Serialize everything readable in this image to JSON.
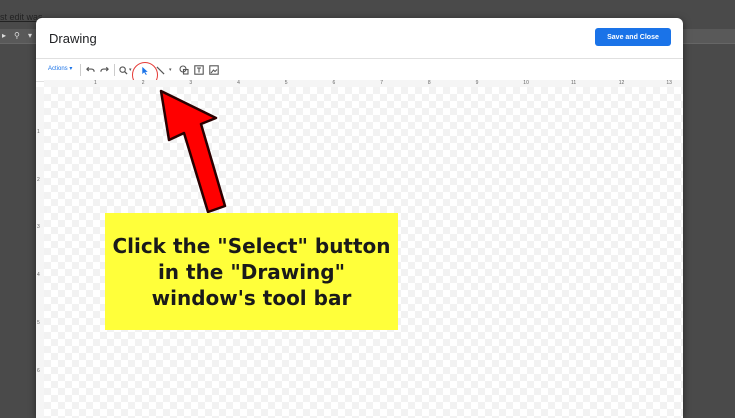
{
  "background": {
    "link_fragment": "st edit was",
    "toolbar_glyphs": [
      "▸",
      "⚲",
      "▾"
    ]
  },
  "dialog": {
    "title": "Drawing",
    "save_label": "Save and Close"
  },
  "toolbar": {
    "actions_label": "Actions ▾",
    "tools": [
      {
        "name": "undo-icon",
        "glyph": "↶"
      },
      {
        "name": "redo-icon",
        "glyph": "↷"
      },
      {
        "name": "zoom-icon",
        "glyph": "⚲"
      },
      {
        "name": "select-icon",
        "glyph": "➤"
      },
      {
        "name": "line-icon",
        "glyph": "╲"
      },
      {
        "name": "shape-icon",
        "glyph": "◯"
      },
      {
        "name": "text-box-icon",
        "glyph": "T"
      },
      {
        "name": "image-icon",
        "glyph": "▣"
      }
    ]
  },
  "ruler": {
    "top_numbers": [
      "1",
      "2",
      "3",
      "4",
      "5",
      "6",
      "7",
      "8",
      "9",
      "10",
      "11",
      "12",
      "13"
    ],
    "left_numbers": [
      "1",
      "2",
      "3",
      "4",
      "5",
      "6"
    ]
  },
  "annotation": {
    "text": "Click the \"Select\" button in the \"Drawing\" window's tool bar"
  },
  "colors": {
    "accent": "#1a73e8",
    "arrow_red": "#ff0000",
    "annotation_yellow": "#ffff3a"
  }
}
